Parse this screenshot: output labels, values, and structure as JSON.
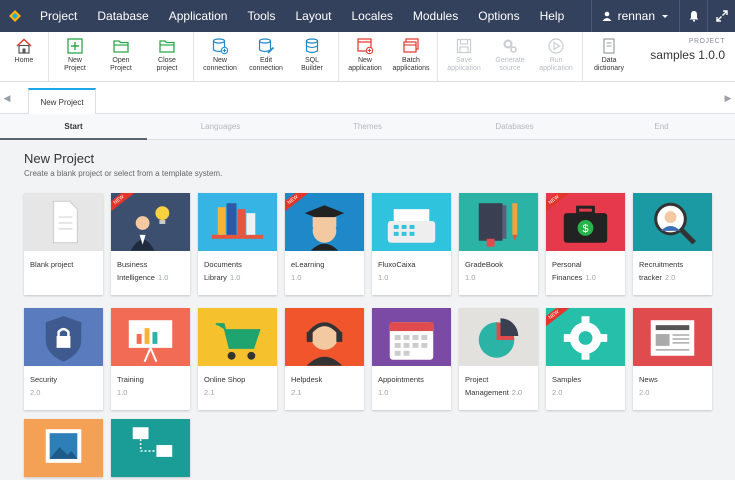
{
  "menu": [
    "Project",
    "Database",
    "Application",
    "Tools",
    "Layout",
    "Locales",
    "Modules",
    "Options",
    "Help"
  ],
  "user": {
    "name": "rennan"
  },
  "toolbar": {
    "home": "Home",
    "new_project": [
      "New",
      "Project"
    ],
    "open_project": [
      "Open",
      "Project"
    ],
    "close_project": [
      "Close",
      "project"
    ],
    "new_connection": [
      "New",
      "connection"
    ],
    "edit_connection": [
      "Edit",
      "connection"
    ],
    "sql_builder": [
      "SQL",
      "Builder"
    ],
    "new_application": [
      "New",
      "application"
    ],
    "batch_applications": [
      "Batch",
      "applications"
    ],
    "save_application": [
      "Save",
      "application"
    ],
    "generate_source": [
      "Generate",
      "source"
    ],
    "run_application": [
      "Run",
      "application"
    ],
    "data_dictionary": [
      "Data",
      "dictionary"
    ]
  },
  "project": {
    "caption": "PROJECT",
    "name": "samples 1.0.0"
  },
  "doc_tab": "New Project",
  "steps": [
    "Start",
    "Languages",
    "Themes",
    "Databases",
    "End"
  ],
  "page": {
    "title": "New Project",
    "subtitle": "Create a blank project or select from a template system."
  },
  "templates": [
    {
      "name": "Blank project",
      "version": "",
      "icon": "blank-page-icon",
      "color": "#e6e6e6",
      "new": false
    },
    {
      "name": "Business Intelligence",
      "version": "1.0",
      "icon": "businessman-lightbulb-icon",
      "color": "#3d4f6e",
      "new": true
    },
    {
      "name": "Documents Library",
      "version": "1.0",
      "icon": "books-icon",
      "color": "#36b4e3",
      "new": false
    },
    {
      "name": "eLearning",
      "version": "1.0",
      "icon": "graduate-icon",
      "color": "#1e88c8",
      "new": true
    },
    {
      "name": "FluxoCaixa",
      "version": "1.0",
      "icon": "cash-register-icon",
      "color": "#2fc3de",
      "new": false
    },
    {
      "name": "GradeBook",
      "version": "1.0",
      "icon": "gradebook-icon",
      "color": "#2bb3a6",
      "new": false
    },
    {
      "name": "Personal Finances",
      "version": "1.0",
      "icon": "money-briefcase-icon",
      "color": "#e6394b",
      "new": true
    },
    {
      "name": "Recruitments tracker",
      "version": "2.0",
      "icon": "recruiter-magnifier-icon",
      "color": "#1b9aa3",
      "new": false
    },
    {
      "name": "Security",
      "version": "2.0",
      "icon": "lock-shield-icon",
      "color": "#5a7bbd",
      "new": false
    },
    {
      "name": "Training",
      "version": "1.0",
      "icon": "presentation-board-icon",
      "color": "#f26b55",
      "new": false
    },
    {
      "name": "Online Shop",
      "version": "2.1",
      "icon": "shopping-cart-icon",
      "color": "#f5c22e",
      "new": false
    },
    {
      "name": "Helpdesk",
      "version": "2.1",
      "icon": "support-agent-icon",
      "color": "#f0552c",
      "new": false
    },
    {
      "name": "Appointments",
      "version": "1.0",
      "icon": "calendar-icon",
      "color": "#7b4aa5",
      "new": false
    },
    {
      "name": "Project Management",
      "version": "2.0",
      "icon": "pie-chart-icon",
      "color": "#e3e1dd",
      "new": false
    },
    {
      "name": "Samples",
      "version": "2.0",
      "icon": "gear-icon",
      "color": "#26bfaa",
      "new": true
    },
    {
      "name": "News",
      "version": "2.0",
      "icon": "newspaper-icon",
      "color": "#e04b4e",
      "new": false
    },
    {
      "name": "",
      "version": "",
      "icon": "picture-frame-icon",
      "color": "#f5a155",
      "new": false
    },
    {
      "name": "",
      "version": "",
      "icon": "network-monitors-icon",
      "color": "#1a9d97",
      "new": false
    }
  ],
  "new_badge": "NEW",
  "colors": {
    "menubar": "#33415c",
    "accent": "#1ea7e8"
  }
}
